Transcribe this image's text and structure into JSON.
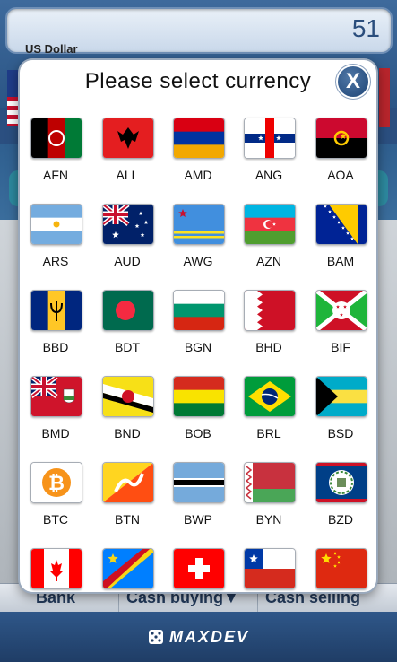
{
  "header": {
    "amount": "51",
    "currency_name": "US Dollar"
  },
  "modal": {
    "title": "Please select currency",
    "close_label": "X"
  },
  "currencies": [
    {
      "code": "AFN",
      "flag": "afghanistan"
    },
    {
      "code": "ALL",
      "flag": "albania"
    },
    {
      "code": "AMD",
      "flag": "armenia"
    },
    {
      "code": "ANG",
      "flag": "netherlands-antilles"
    },
    {
      "code": "AOA",
      "flag": "angola"
    },
    {
      "code": "ARS",
      "flag": "argentina"
    },
    {
      "code": "AUD",
      "flag": "australia"
    },
    {
      "code": "AWG",
      "flag": "aruba"
    },
    {
      "code": "AZN",
      "flag": "azerbaijan"
    },
    {
      "code": "BAM",
      "flag": "bosnia"
    },
    {
      "code": "BBD",
      "flag": "barbados"
    },
    {
      "code": "BDT",
      "flag": "bangladesh"
    },
    {
      "code": "BGN",
      "flag": "bulgaria"
    },
    {
      "code": "BHD",
      "flag": "bahrain"
    },
    {
      "code": "BIF",
      "flag": "burundi"
    },
    {
      "code": "BMD",
      "flag": "bermuda"
    },
    {
      "code": "BND",
      "flag": "brunei"
    },
    {
      "code": "BOB",
      "flag": "bolivia"
    },
    {
      "code": "BRL",
      "flag": "brazil"
    },
    {
      "code": "BSD",
      "flag": "bahamas"
    },
    {
      "code": "BTC",
      "flag": "bitcoin"
    },
    {
      "code": "BTN",
      "flag": "bhutan"
    },
    {
      "code": "BWP",
      "flag": "botswana"
    },
    {
      "code": "BYN",
      "flag": "belarus"
    },
    {
      "code": "BZD",
      "flag": "belize"
    },
    {
      "code": "",
      "flag": "canada"
    },
    {
      "code": "",
      "flag": "dr-congo"
    },
    {
      "code": "",
      "flag": "switzerland"
    },
    {
      "code": "",
      "flag": "chile"
    },
    {
      "code": "",
      "flag": "china"
    }
  ],
  "table_header": {
    "bank": "Bank",
    "cash_buying": "Cash buying▼",
    "cash_selling": "Cash selling"
  },
  "footer": {
    "logo_text": "MAXDEV"
  },
  "colors": {
    "accent": "#2b4f80",
    "close_button": "#1e4475"
  }
}
